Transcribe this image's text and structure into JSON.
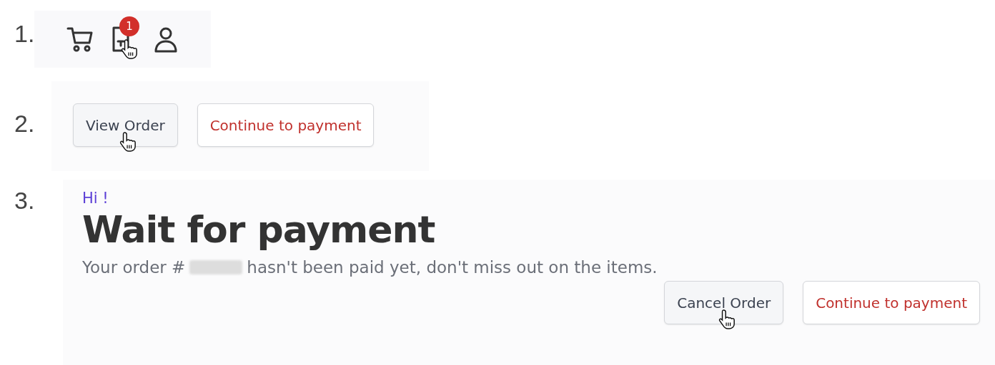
{
  "steps": [
    {
      "number": "1.",
      "kind": "icons",
      "icons": [
        {
          "kind": "cart"
        },
        {
          "kind": "document",
          "badge": "1",
          "cursor": true
        },
        {
          "kind": "user"
        }
      ]
    },
    {
      "number": "2.",
      "kind": "buttons",
      "buttons": [
        {
          "label": "View Order",
          "kind": "plain",
          "cursor": true
        },
        {
          "label": "Continue to payment",
          "kind": "accent",
          "cursor": false
        }
      ]
    },
    {
      "number": "3.",
      "kind": "card",
      "greeting": "Hi !",
      "title": "Wait for payment",
      "message_start": "Your order #",
      "message_redacted": true,
      "message_end": "hasn't been paid yet, don't miss out on the items.",
      "buttons": [
        {
          "label": "Cancel Order",
          "kind": "plain",
          "cursor": true
        },
        {
          "label": "Continue to payment",
          "kind": "accent",
          "cursor": false
        }
      ]
    }
  ]
}
